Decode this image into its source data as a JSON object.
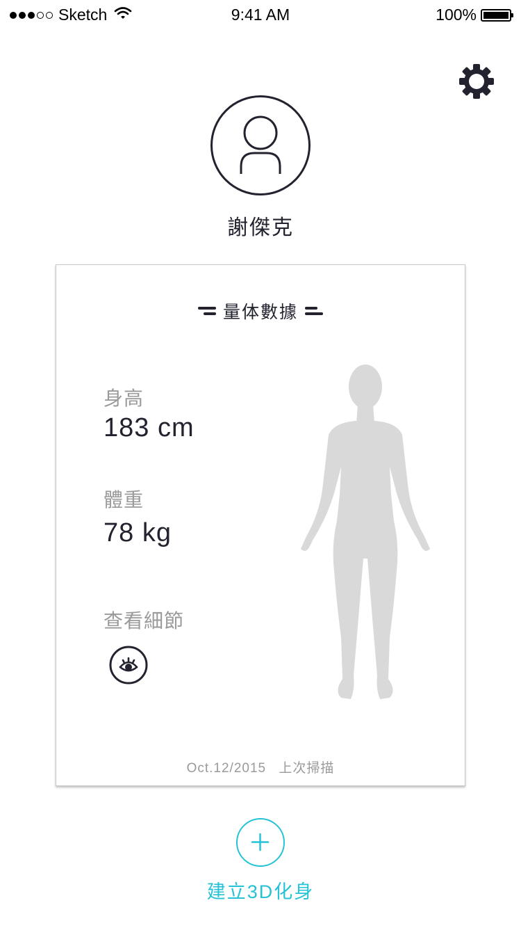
{
  "status_bar": {
    "carrier": "Sketch",
    "time": "9:41 AM",
    "battery": "100%"
  },
  "profile": {
    "name": "謝傑克"
  },
  "card": {
    "title": "量体數據",
    "height_label": "身高",
    "height_value": "183 cm",
    "weight_label": "體重",
    "weight_value": "78 kg",
    "details_label": "查看細節",
    "scan_date": "Oct.12/2015",
    "scan_label": "上次掃描"
  },
  "create": {
    "label": "建立3D化身"
  },
  "colors": {
    "primary": "#22232e",
    "accent": "#26c2d6",
    "muted": "#9a9a9a",
    "figure": "#d9d9d9"
  },
  "icons": [
    "signal-dots-icon",
    "wifi-icon",
    "battery-icon",
    "gear-icon",
    "user-icon",
    "eye-icon",
    "body-figure",
    "plus-icon"
  ]
}
